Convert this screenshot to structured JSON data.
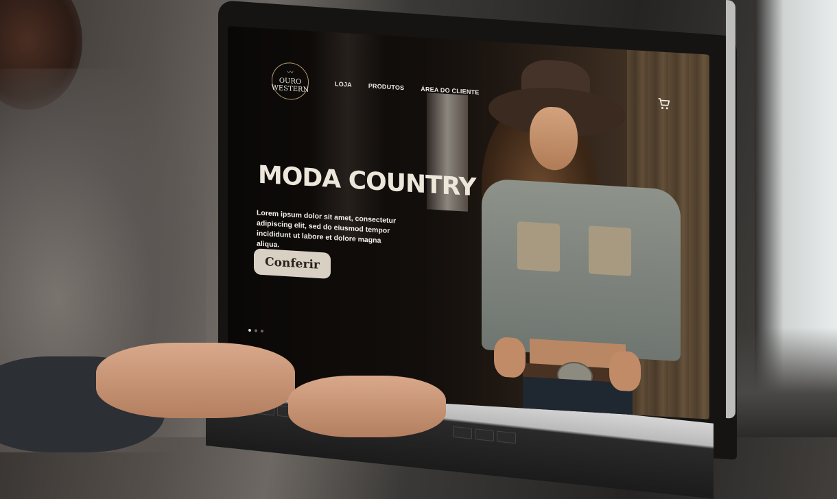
{
  "brand": {
    "name_line1": "OURO",
    "name_line2": "WESTERN"
  },
  "nav": {
    "items": [
      "LOJA",
      "PRODUTOS",
      "ÁREA DO CLIENTE"
    ]
  },
  "icons": {
    "cart": "cart-icon",
    "logo_bird": "bird-icon"
  },
  "hero": {
    "title": "MODA COUNTRY",
    "text": "Lorem ipsum dolor sit amet, consectetur adipiscing elit, sed do eiusmod tempor incididunt ut labore et dolore magna aliqua.",
    "cta_label": "Conferir"
  },
  "carousel": {
    "total_slides": 3,
    "active_slide": 1
  },
  "colors": {
    "accent": "#d9d0c4",
    "text_light": "#ece6db",
    "logo_ring": "#b49a74"
  }
}
